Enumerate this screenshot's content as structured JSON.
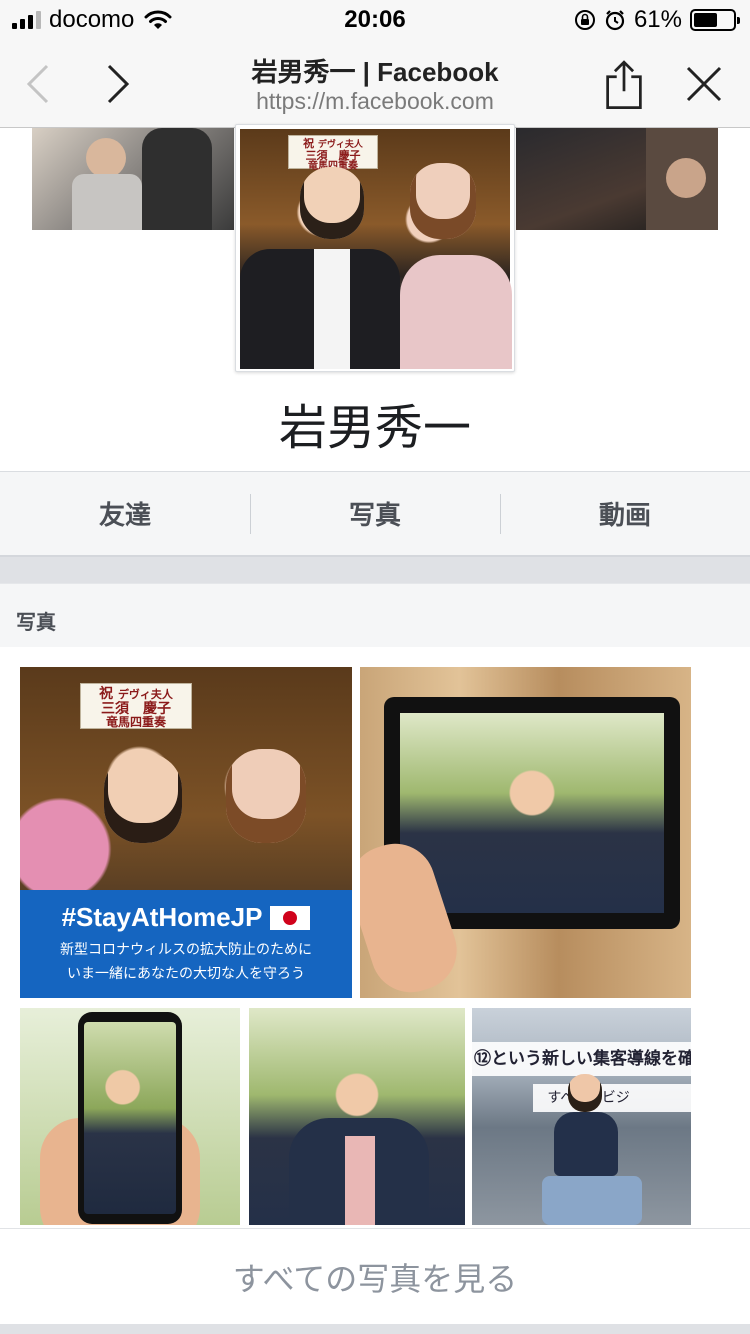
{
  "status_bar": {
    "carrier": "docomo",
    "time": "20:06",
    "battery_percent": "61%",
    "battery_level": 0.61,
    "icons": [
      "signal-icon",
      "wifi-icon",
      "orientation-lock-icon",
      "alarm-icon",
      "battery-icon"
    ]
  },
  "browser": {
    "title": "岩男秀一 | Facebook",
    "url": "https://m.facebook.com",
    "icons": [
      "back-arrow-icon",
      "forward-arrow-icon",
      "share-icon",
      "close-icon"
    ]
  },
  "profile": {
    "name": "岩男秀一",
    "cover_sign": {
      "line1": "祝",
      "line2": "デヴィ夫人",
      "line3": "三須　慶子",
      "line4": "竜馬四重奏"
    }
  },
  "tabs": [
    {
      "label": "友達"
    },
    {
      "label": "写真"
    },
    {
      "label": "動画"
    }
  ],
  "photos_section": {
    "title": "写真",
    "stay_home": {
      "hashtag": "#StayAtHomeJP",
      "line1": "新型コロナウィルスの拡大防止のために",
      "line2": "いま一緒にあなたの大切な人を守ろう"
    },
    "banner": {
      "line1": "⑫という新しい集客導線を確保しな",
      "line2": "すべてのビジ"
    },
    "see_all": "すべての写真を見る"
  },
  "colors": {
    "facebook_grey": "#f5f6f7",
    "link_grey": "#8d949e",
    "stay_home_blue": "#1565c0"
  }
}
